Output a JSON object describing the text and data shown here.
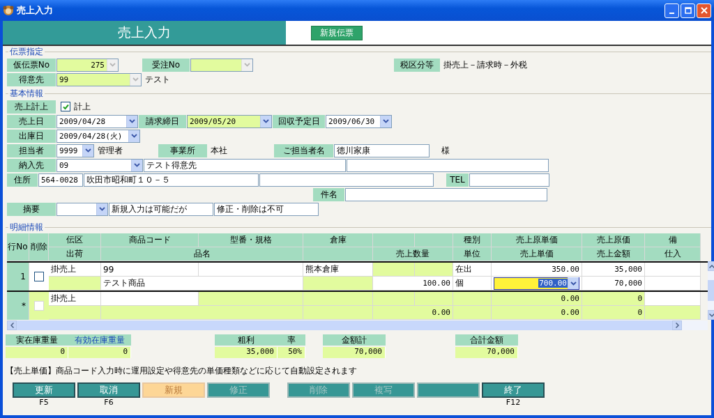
{
  "window": {
    "title": "売上入力"
  },
  "header": {
    "title": "売上入力",
    "badge": "新規伝票"
  },
  "slip": {
    "legend": "伝票指定",
    "temp_no": {
      "label": "仮伝票No",
      "value": "275",
      "disabled": true
    },
    "order_no": {
      "label": "受注No",
      "disabled": true
    },
    "tax": {
      "label": "税区分等",
      "value": "掛売上－請求時－外税"
    },
    "customer": {
      "label": "得意先",
      "value": "99",
      "disabled": true,
      "name": "テスト"
    }
  },
  "basic": {
    "legend": "基本情報",
    "sales_record": {
      "label": "売上計上",
      "checked": true,
      "text": "計上"
    },
    "sales_date": {
      "label": "売上日",
      "value": "2009/04/28"
    },
    "billing_close": {
      "label": "請求締日",
      "value": "2009/05/20"
    },
    "collection_date": {
      "label": "回収予定日",
      "value": "2009/06/30"
    },
    "ship_date": {
      "label": "出庫日",
      "value": "2009/04/28(火)"
    },
    "staff": {
      "label": "担当者",
      "value": "9999",
      "name": "管理者"
    },
    "office": {
      "label": "事業所",
      "value": "本社"
    },
    "contact": {
      "label": "ご担当者名",
      "value": "徳川家康",
      "suffix": "様"
    },
    "delivery": {
      "label": "納入先",
      "value": "09",
      "name": "テスト得意先"
    },
    "address": {
      "label": "住所",
      "postal": "564-0028",
      "line1": "吹田市昭和町１０－５"
    },
    "tel": {
      "label": "TEL"
    },
    "subject": {
      "label": "件名"
    },
    "summary": {
      "label": "摘要",
      "note1": "新規入力は可能だが",
      "note2": "修正・削除は不可"
    }
  },
  "detail": {
    "legend": "明細情報",
    "row_no_label": "行No",
    "delete_label": "削除",
    "header_top": [
      {
        "kind": "label",
        "text": "伝区"
      },
      {
        "kind": "label",
        "text": "商品コード"
      },
      {
        "kind": "label",
        "text": "型番・規格"
      },
      {
        "kind": "label",
        "text": "倉庫"
      },
      {
        "kind": "blank"
      },
      {
        "kind": "blank"
      },
      {
        "kind": "label",
        "text": "種別"
      },
      {
        "kind": "label",
        "text": "売上原単価"
      },
      {
        "kind": "label",
        "text": "売上原価"
      },
      {
        "kind": "label",
        "text": "備"
      }
    ],
    "header_bottom": [
      {
        "kind": "label",
        "text": "出荷"
      },
      {
        "kind": "label",
        "text": "品名"
      },
      {
        "kind": "blank"
      },
      {
        "kind": "label",
        "text": "売上数量"
      },
      {
        "kind": "label",
        "text": "単位"
      },
      {
        "kind": "label",
        "text": "売上単価"
      },
      {
        "kind": "label",
        "text": "売上金額"
      },
      {
        "kind": "label",
        "text": "仕入"
      }
    ],
    "rows": [
      {
        "row_no": "1",
        "checked": false,
        "disabled": false,
        "lines": [
          [
            {
              "text": "掛売上",
              "editable": false
            },
            {
              "text": "99",
              "editable": false
            },
            {
              "editable": false
            },
            {
              "text": "熊本倉庫",
              "editable": false
            },
            {
              "editable": true
            },
            {
              "editable": true
            },
            {
              "text": "在出",
              "editable": false
            },
            {
              "text": "350.00",
              "editable": false
            },
            {
              "text": "35,000",
              "editable": false
            },
            {
              "editable": false
            }
          ],
          [
            {
              "editable": true
            },
            {
              "text": "テスト商品",
              "editable": false
            },
            {
              "editable": true
            },
            {
              "text": "100.00",
              "editable": false
            },
            {
              "text": "個",
              "editable": false
            },
            {
              "text": "700.00",
              "kind": "dropdown",
              "focused": true
            },
            {
              "text": "70,000",
              "editable": false
            },
            {
              "editable": false
            }
          ]
        ]
      },
      {
        "row_no": "*",
        "checked": false,
        "disabled": true,
        "lines": [
          [
            {
              "text": "掛売上",
              "editable": false
            },
            {
              "editable": false
            },
            {
              "editable": true
            },
            {
              "editable": true
            },
            {
              "editable": true
            },
            {
              "editable": true
            },
            {
              "editable": true
            },
            {
              "text": "0.00",
              "editable": true
            },
            {
              "text": "0",
              "editable": true
            },
            {
              "editable": false
            }
          ],
          [
            {
              "editable": true
            },
            {
              "editable": true
            },
            {
              "editable": true
            },
            {
              "text": "0.00",
              "editable": true
            },
            {
              "editable": true
            },
            {
              "text": "0.00",
              "editable": true
            },
            {
              "text": "0",
              "editable": true
            },
            {
              "editable": true
            }
          ]
        ]
      }
    ]
  },
  "totals": [
    [
      {
        "label": "実在庫重量",
        "value": "0",
        "kind": "plain"
      },
      {
        "label": "有効在庫重量",
        "value": "0",
        "kind": "link"
      }
    ],
    [
      {
        "label": "粗利",
        "value": "35,000",
        "kind": "plain"
      },
      {
        "label": "率",
        "value": "50%",
        "kind": "plain"
      }
    ],
    [
      {
        "label": "金額計",
        "value": "70,000",
        "kind": "plain"
      }
    ],
    [
      {
        "label": "合計金額",
        "value": "70,000",
        "kind": "plain"
      }
    ]
  ],
  "message": "【売上単価】商品コード入力時に運用設定や得意先の単価種類などに応じて自動設定されます",
  "buttons": [
    {
      "label": "更新",
      "key": "F5",
      "highlighted": false,
      "disabled": false
    },
    {
      "label": "取消",
      "key": "F6",
      "highlighted": false,
      "disabled": false
    },
    {
      "label": "新規",
      "highlighted": true,
      "disabled": false
    },
    {
      "label": "修正",
      "highlighted": false,
      "disabled": true
    },
    {
      "label": "削除",
      "highlighted": false,
      "disabled": true
    },
    {
      "label": "複写",
      "highlighted": false,
      "disabled": true
    },
    {
      "highlighted": false,
      "disabled": true
    },
    {
      "label": "終了",
      "key": "F12",
      "highlighted": false,
      "disabled": false
    }
  ]
}
